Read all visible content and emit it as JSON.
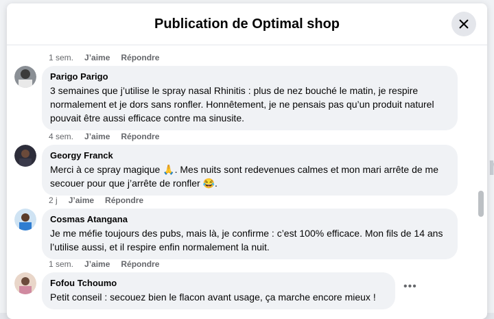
{
  "modal": {
    "title": "Publication de Optimal shop"
  },
  "comments": [
    {
      "author": "",
      "text": "",
      "time": "1 sem.",
      "like_label": "J’aime",
      "reply_label": "Répondre"
    },
    {
      "author": "Parigo Parigo",
      "text": "3 semaines que j’utilise le spray nasal Rhinitis : plus de nez bouché le matin, je respire normalement et je dors sans ronfler. Honnêtement, je ne pensais pas qu’un produit naturel pouvait être aussi efficace contre ma sinusite.",
      "time": "4 sem.",
      "like_label": "J’aime",
      "reply_label": "Répondre"
    },
    {
      "author": "Georgy Franck",
      "text_part1": "Merci à ce spray magique 🙏. Mes nuits sont redevenues calmes et mon mari arrête de me secouer pour que j’arrête de ronfler 😂.",
      "time": "2 j",
      "like_label": "J’aime",
      "reply_label": "Répondre"
    },
    {
      "author": "Cosmas Atangana",
      "text": "Je me méfie toujours des pubs, mais là, je confirme : c’est 100% efficace. Mon fils de 14 ans l’utilise aussi, et il respire enfin normalement la nuit.",
      "time": "1 sem.",
      "like_label": "J’aime",
      "reply_label": "Répondre"
    },
    {
      "author": "Fofou Tchoumo",
      "text": "Petit conseil : secouez bien le flacon avant usage, ça marche encore mieux !",
      "more_icon": "more-horizontal-icon"
    }
  ]
}
